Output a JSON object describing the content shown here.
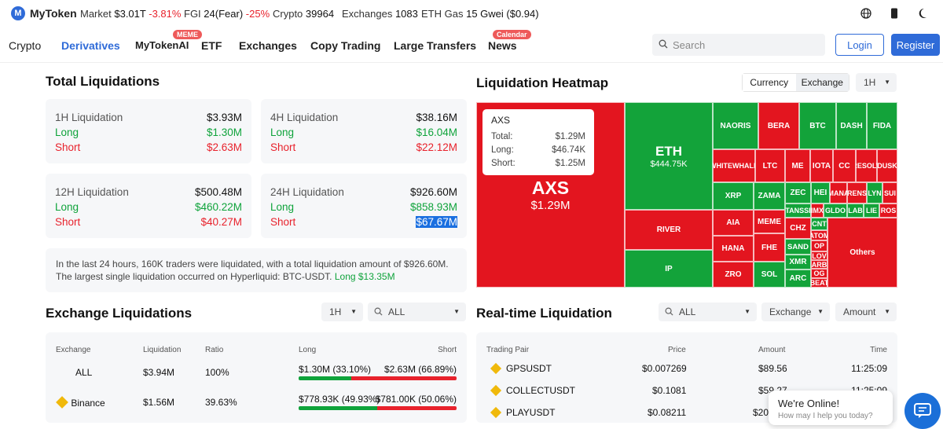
{
  "topbar": {
    "brand": "MyToken",
    "market_label": "Market",
    "market_value": "$3.01T",
    "market_change": "-3.81%",
    "fgi_label": "FGI",
    "fgi_value": "24(Fear)",
    "fgi_change": "-25%",
    "crypto_label": "Crypto",
    "crypto_value": "39964",
    "exchanges_label": "Exchanges",
    "exchanges_value": "1083",
    "gas_label": "ETH Gas",
    "gas_value": "15 Gwei ($0.94)",
    "icons": [
      "globe-icon",
      "phone-icon",
      "moon-icon"
    ]
  },
  "nav": {
    "items": [
      "Crypto",
      "Derivatives",
      "MyTokenAI",
      "ETF",
      "Exchanges",
      "Copy Trading",
      "Large Transfers",
      "News"
    ],
    "active": "Derivatives",
    "badge_meme": "MEME",
    "badge_calendar": "Calendar",
    "search_placeholder": "Search",
    "login": "Login",
    "register": "Register"
  },
  "total": {
    "title": "Total Liquidations",
    "cards": [
      {
        "label": "1H Liquidation",
        "total": "$3.93M",
        "long_label": "Long",
        "long": "$1.30M",
        "short_label": "Short",
        "short": "$2.63M"
      },
      {
        "label": "4H Liquidation",
        "total": "$38.16M",
        "long_label": "Long",
        "long": "$16.04M",
        "short_label": "Short",
        "short": "$22.12M"
      },
      {
        "label": "12H Liquidation",
        "total": "$500.48M",
        "long_label": "Long",
        "long": "$460.22M",
        "short_label": "Short",
        "short": "$40.27M"
      },
      {
        "label": "24H Liquidation",
        "total": "$926.60M",
        "long_label": "Long",
        "long": "$858.93M",
        "short_label": "Short",
        "short": "$67.67M"
      }
    ],
    "summary_1": "In the last 24 hours, 160K traders were liquidated, with a total liquidation amount of $926.60M.",
    "summary_2": "The largest single liquidation occurred on Hyperliquid: BTC-USDT.",
    "summary_3": "Long $13.35M"
  },
  "heatmap": {
    "title": "Liquidation Heatmap",
    "seg_currency": "Currency",
    "seg_exchange": "Exchange",
    "period": "1H",
    "cells": [
      {
        "name": "AXS",
        "value": "$1.29M",
        "color": "#e3151f"
      },
      {
        "name": "ETH",
        "value": "$444.75K",
        "color": "#13a33a"
      },
      {
        "name": "NAORIS"
      },
      {
        "name": "BERA"
      },
      {
        "name": "BTC"
      },
      {
        "name": "DASH"
      },
      {
        "name": "FIDA"
      },
      {
        "name": "WHITEWHALE"
      },
      {
        "name": "LTC"
      },
      {
        "name": "ME"
      },
      {
        "name": "IOTA"
      },
      {
        "name": "CC"
      },
      {
        "name": "RESOLV"
      },
      {
        "name": "DUSK"
      },
      {
        "name": "XRP"
      },
      {
        "name": "ZAMA"
      },
      {
        "name": "ZEC"
      },
      {
        "name": "HEI"
      },
      {
        "name": "MANA"
      },
      {
        "name": "RENS"
      },
      {
        "name": "LYN"
      },
      {
        "name": "SUI"
      },
      {
        "name": "TANSSI"
      },
      {
        "name": "IMX"
      },
      {
        "name": "GLDO"
      },
      {
        "name": "LAB"
      },
      {
        "name": "LIE"
      },
      {
        "name": "ROS"
      },
      {
        "name": "RIVER"
      },
      {
        "name": "AIA"
      },
      {
        "name": "MEME"
      },
      {
        "name": "CHZ"
      },
      {
        "name": "CNT"
      },
      {
        "name": "ATOM"
      },
      {
        "name": "HANA"
      },
      {
        "name": "FHE"
      },
      {
        "name": "SAND"
      },
      {
        "name": "OP"
      },
      {
        "name": "LOV"
      },
      {
        "name": "Others"
      },
      {
        "name": "IP"
      },
      {
        "name": "XMR"
      },
      {
        "name": "ARB"
      },
      {
        "name": "OG"
      },
      {
        "name": "ZRO"
      },
      {
        "name": "SOL"
      },
      {
        "name": "ARC"
      },
      {
        "name": "BEAT"
      }
    ],
    "tooltip": {
      "name": "AXS",
      "total_label": "Total:",
      "total": "$1.29M",
      "long_label": "Long:",
      "long": "$46.74K",
      "short_label": "Short:",
      "short": "$1.25M"
    }
  },
  "exchange_liq": {
    "title": "Exchange Liquidations",
    "period": "1H",
    "filter": "ALL",
    "headers": [
      "Exchange",
      "Liquidation",
      "Ratio",
      "Long",
      "Short"
    ],
    "rows": [
      {
        "exchange": "ALL",
        "liq": "$3.94M",
        "ratio": "100%",
        "long": "$1.30M (33.10%)",
        "short": "$2.63M (66.89%)",
        "long_pct": 33.1
      },
      {
        "exchange": "Binance",
        "liq": "$1.56M",
        "ratio": "39.63%",
        "long": "$778.93K (49.93%)",
        "short": "$781.00K (50.06%)",
        "long_pct": 49.93
      }
    ]
  },
  "realtime": {
    "title": "Real-time Liquidation",
    "filter": "ALL",
    "exchange": "Exchange",
    "amount": "Amount",
    "headers": [
      "Trading Pair",
      "Price",
      "Amount",
      "Time"
    ],
    "rows": [
      {
        "pair": "GPSUSDT",
        "price": "$0.007269",
        "amount": "$89.56",
        "time": "11:25:09"
      },
      {
        "pair": "COLLECTUSDT",
        "price": "$0.1081",
        "amount": "$59.27",
        "time": "11:25:09"
      },
      {
        "pair": "PLAYUSDT",
        "price": "$0.08211",
        "amount": "$20",
        "time": ""
      }
    ]
  },
  "chat": {
    "title": "We're Online!",
    "sub": "How may I help you today?"
  }
}
